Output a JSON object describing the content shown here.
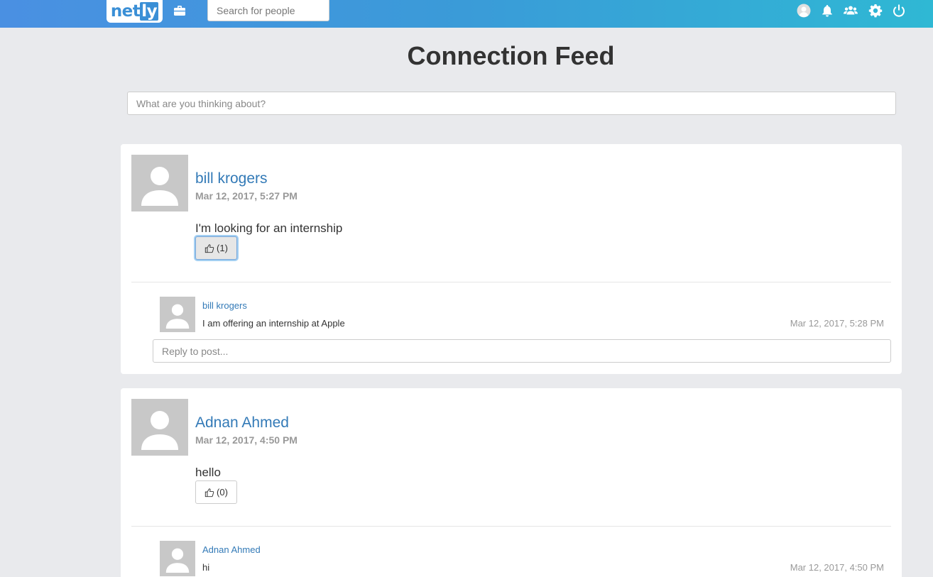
{
  "app": {
    "logo_text": "netly",
    "search_placeholder": "Search for people"
  },
  "page": {
    "title": "Connection Feed",
    "compose_placeholder": "What are you thinking about?",
    "reply_placeholder": "Reply to post..."
  },
  "posts": [
    {
      "author": "bill krogers",
      "date": "Mar 12, 2017, 5:27 PM",
      "body": "I'm looking for an internship",
      "likes": "(1)",
      "reply": {
        "author": "bill krogers",
        "text": "I am offering an internship at Apple",
        "date": "Mar 12, 2017, 5:28 PM"
      }
    },
    {
      "author": "Adnan Ahmed",
      "date": "Mar 12, 2017, 4:50 PM",
      "body": "hello",
      "likes": "(0)",
      "reply": {
        "author": "Adnan Ahmed",
        "text": "hi",
        "date": "Mar 12, 2017, 4:50 PM"
      }
    }
  ],
  "nav_icons": [
    "briefcase-icon",
    "profile-avatar-icon",
    "bell-icon",
    "connections-icon",
    "gear-icon",
    "power-icon"
  ]
}
